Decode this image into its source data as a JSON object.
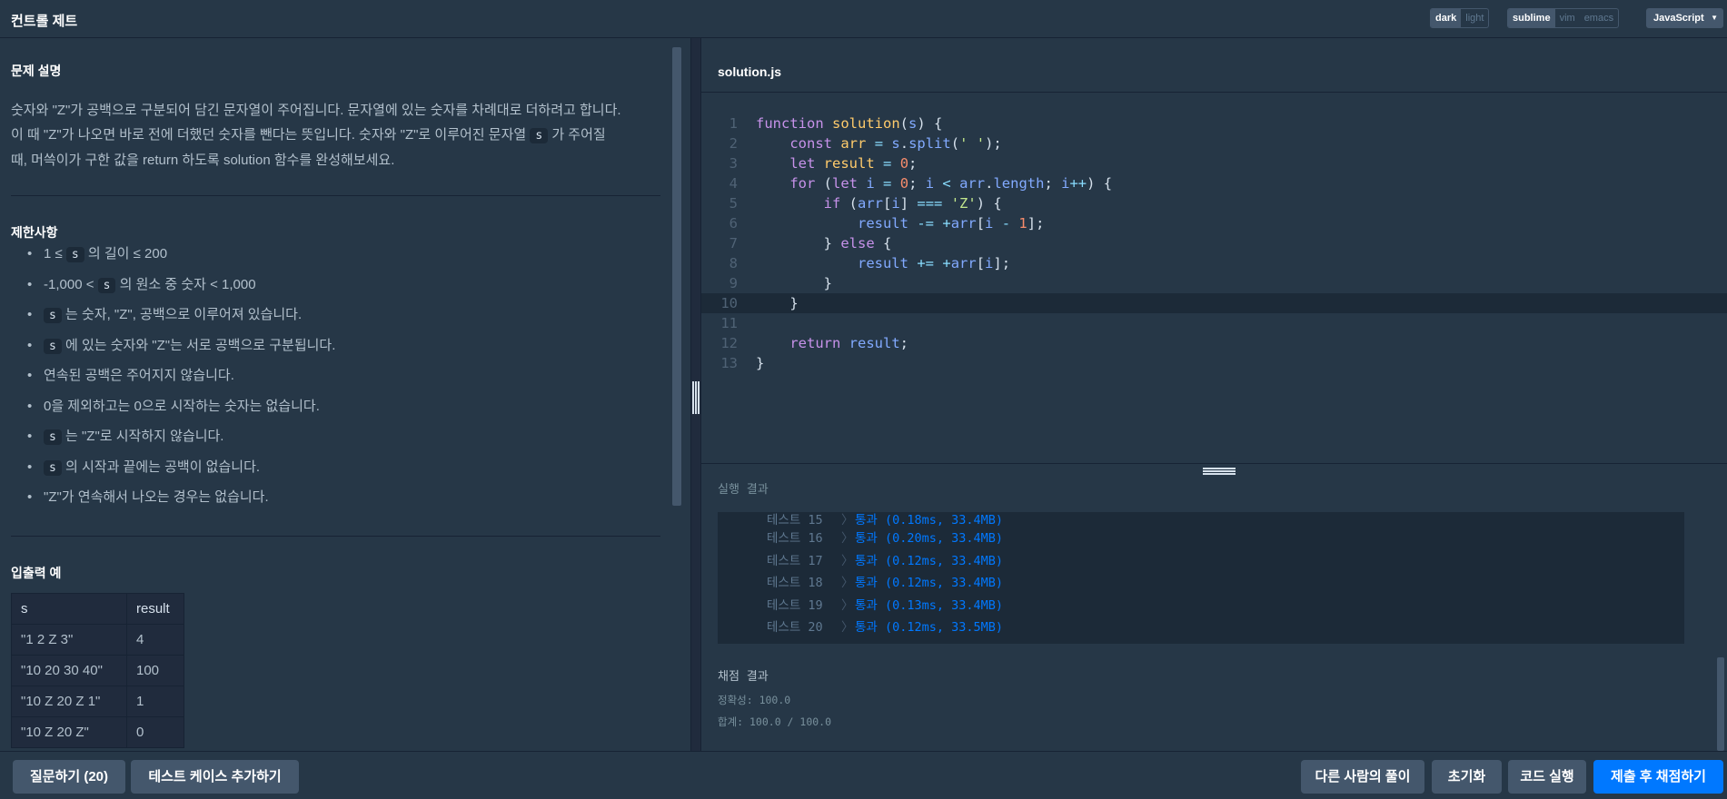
{
  "app_title": "컨트롤 제트",
  "theme": {
    "options": [
      "dark",
      "light"
    ],
    "selected": "dark"
  },
  "keymap": {
    "options": [
      "sublime",
      "vim",
      "emacs"
    ],
    "selected": "sublime"
  },
  "language": {
    "selected": "JavaScript"
  },
  "problem": {
    "description_title": "문제 설명",
    "description": {
      "p1": "숫자와 \"Z\"가 공백으로 구분되어 담긴 문자열이 주어집니다. 문자열에 있는 숫자를 차례대로 더하려고 합니다.",
      "p2a": "이 때 \"Z\"가 나오면 바로 전에 더했던 숫자를 뺀다는 뜻입니다. 숫자와 \"Z\"로 이루어진 문자열 ",
      "p2_code": "s",
      "p2b": " 가 주어질",
      "p3": "때, 머쓱이가 구한 값을 return 하도록 solution 함수를 완성해보세요."
    },
    "constraints_title": "제한사항",
    "constraints": [
      {
        "pre": "1 ≤ ",
        "code": "s",
        "post": " 의 길이 ≤ 200"
      },
      {
        "pre": "-1,000 < ",
        "code": "s",
        "post": " 의 원소 중 숫자 < 1,000"
      },
      {
        "pre": "",
        "code": "s",
        "post": " 는 숫자, \"Z\", 공백으로 이루어져 있습니다."
      },
      {
        "pre": "",
        "code": "s",
        "post": " 에 있는 숫자와 \"Z\"는 서로 공백으로 구분됩니다."
      },
      {
        "pre": "연속된 공백은 주어지지 않습니다.",
        "code": "",
        "post": ""
      },
      {
        "pre": "0을 제외하고는 0으로 시작하는 숫자는 없습니다.",
        "code": "",
        "post": ""
      },
      {
        "pre": "",
        "code": "s",
        "post": " 는 \"Z\"로 시작하지 않습니다."
      },
      {
        "pre": "",
        "code": "s",
        "post": " 의 시작과 끝에는 공백이 없습니다."
      },
      {
        "pre": "\"Z\"가 연속해서 나오는 경우는 없습니다.",
        "code": "",
        "post": ""
      }
    ],
    "examples_title": "입출력 예",
    "examples_table": {
      "headers": [
        "s",
        "result"
      ],
      "rows": [
        [
          "\"1 2 Z 3\"",
          "4"
        ],
        [
          "\"10 20 30 40\"",
          "100"
        ],
        [
          "\"10 Z 20 Z 1\"",
          "1"
        ],
        [
          "\"10 Z 20 Z\"",
          "0"
        ]
      ]
    }
  },
  "editor": {
    "filename": "solution.js",
    "line_numbers": [
      "1",
      "2",
      "3",
      "4",
      "5",
      "6",
      "7",
      "8",
      "9",
      "10",
      "11",
      "12",
      "13"
    ]
  },
  "results": {
    "title": "실행 결과",
    "tests": [
      {
        "label": "테스트 15",
        "sep": "〉",
        "status": "통과 (0.18ms, 33.4MB)"
      },
      {
        "label": "테스트 16",
        "sep": "〉",
        "status": "통과 (0.20ms, 33.4MB)"
      },
      {
        "label": "테스트 17",
        "sep": "〉",
        "status": "통과 (0.12ms, 33.4MB)"
      },
      {
        "label": "테스트 18",
        "sep": "〉",
        "status": "통과 (0.12ms, 33.4MB)"
      },
      {
        "label": "테스트 19",
        "sep": "〉",
        "status": "통과 (0.13ms, 33.4MB)"
      },
      {
        "label": "테스트 20",
        "sep": "〉",
        "status": "통과 (0.12ms, 33.5MB)"
      }
    ],
    "grading_title": "채점 결과",
    "accuracy": "정확성: 100.0",
    "total": "합계: 100.0 / 100.0"
  },
  "bottom": {
    "ask": "질문하기 (20)",
    "add_testcase": "테스트 케이스 추가하기",
    "others": "다른 사람의 풀이",
    "reset": "초기화",
    "run": "코드 실행",
    "submit": "제출 후 채점하기"
  },
  "colors": {
    "background": "#263747",
    "accent": "#0078ff",
    "button": "#44576c"
  }
}
